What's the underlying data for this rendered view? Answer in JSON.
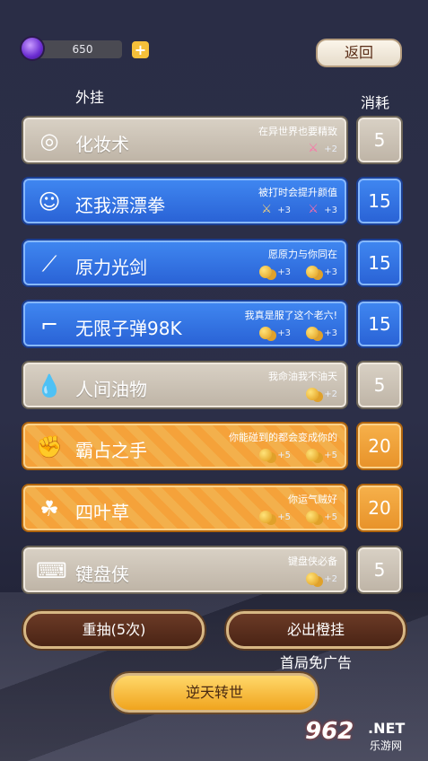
{
  "top": {
    "gem_count": "650",
    "plus_label": "+",
    "back_label": "返回"
  },
  "headers": {
    "left": "外挂",
    "right": "消耗"
  },
  "rows": [
    {
      "name": "化妆术",
      "desc": "在异世界也要精致",
      "theme": "gray",
      "cost": "5",
      "bonuses": [
        {
          "icon": "crossed-swords-pink-icon",
          "text": "+2"
        }
      ]
    },
    {
      "name": "还我漂漂拳",
      "desc": "被打时会提升颜值",
      "theme": "blue",
      "cost": "15",
      "bonuses": [
        {
          "icon": "crossed-swords-icon",
          "text": "+3"
        },
        {
          "icon": "crossed-swords-pink-icon",
          "text": "+3"
        }
      ]
    },
    {
      "name": "原力光剑",
      "desc": "愿原力与你同在",
      "theme": "blue",
      "cost": "15",
      "bonuses": [
        {
          "icon": "coins-icon",
          "text": "+3"
        },
        {
          "icon": "coins-icon",
          "text": "+3"
        }
      ]
    },
    {
      "name": "无限子弹98K",
      "desc": "我真是服了这个老六!",
      "theme": "blue",
      "cost": "15",
      "bonuses": [
        {
          "icon": "coins-icon",
          "text": "+3"
        },
        {
          "icon": "coins-icon",
          "text": "+3"
        }
      ]
    },
    {
      "name": "人间油物",
      "desc": "我命油我不油天",
      "theme": "gray",
      "cost": "5",
      "bonuses": [
        {
          "icon": "coins-icon",
          "text": "+2"
        }
      ]
    },
    {
      "name": "霸占之手",
      "desc": "你能碰到的都会变成你的",
      "theme": "orange",
      "cost": "20",
      "bonuses": [
        {
          "icon": "coins-icon",
          "text": "+5"
        },
        {
          "icon": "coins-icon",
          "text": "+5"
        }
      ]
    },
    {
      "name": "四叶草",
      "desc": "你运气贼好",
      "theme": "orange",
      "cost": "20",
      "bonuses": [
        {
          "icon": "coins-icon",
          "text": "+5"
        },
        {
          "icon": "coins-icon",
          "text": "+5"
        }
      ]
    },
    {
      "name": "键盘侠",
      "desc": "键盘侠必备",
      "theme": "gray",
      "cost": "5",
      "bonuses": [
        {
          "icon": "coins-icon",
          "text": "+2"
        }
      ]
    }
  ],
  "buttons": {
    "reroll": "重抽(5次)",
    "guarantee_orange": "必出橙挂",
    "free_ad": "首局免广告",
    "rebirth": "逆天转世"
  },
  "watermark": {
    "number": "962",
    "net": ".NET",
    "site": "乐游网"
  }
}
